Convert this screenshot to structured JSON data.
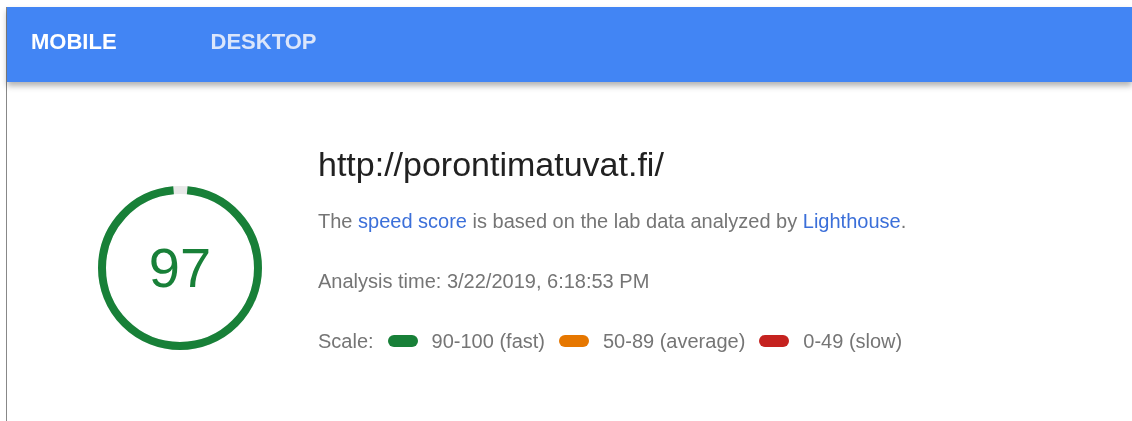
{
  "tabs": [
    {
      "label": "MOBILE",
      "selected": true
    },
    {
      "label": "DESKTOP",
      "selected": false
    }
  ],
  "score": {
    "value": "97",
    "color": "#188038"
  },
  "url": "http://porontimatuvat.fi/",
  "description": [
    {
      "kind": "text",
      "text": "The "
    },
    {
      "kind": "link",
      "text": "speed score"
    },
    {
      "kind": "text",
      "text": " is based on the lab data analyzed by "
    },
    {
      "kind": "link",
      "text": "Lighthouse"
    },
    {
      "kind": "text",
      "text": "."
    }
  ],
  "analysis_time": "Analysis time: 3/22/2019, 6:18:53 PM",
  "scale": {
    "label": "Scale:",
    "items": [
      {
        "label": "90-100 (fast)",
        "color": "#188038"
      },
      {
        "label": "50-89 (average)",
        "color": "#e67700"
      },
      {
        "label": "0-49 (slow)",
        "color": "#c5221f"
      }
    ]
  }
}
